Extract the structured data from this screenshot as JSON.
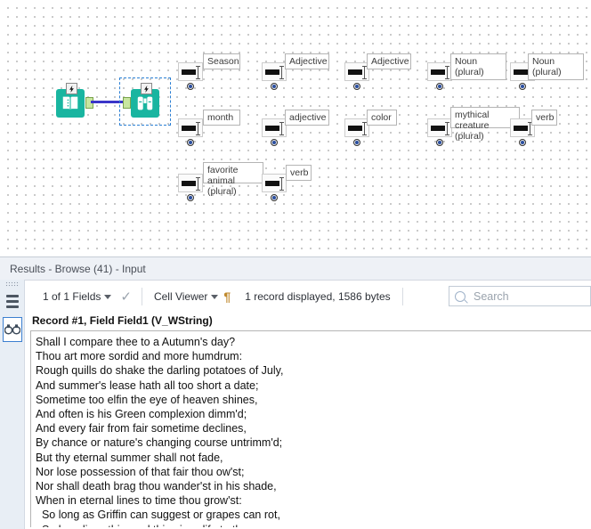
{
  "canvas": {
    "tools": [
      {
        "name": "input-tool",
        "label": "Input",
        "icon": "book-icon"
      },
      {
        "name": "browse-tool",
        "label": "Browse",
        "icon": "binoculars-icon",
        "selected": true
      }
    ],
    "text_widgets": [
      {
        "id": "w1",
        "label": "Season",
        "row": 1,
        "col": 1
      },
      {
        "id": "w2",
        "label": "Adjective",
        "row": 1,
        "col": 2
      },
      {
        "id": "w3",
        "label": "Adjective",
        "row": 1,
        "col": 3
      },
      {
        "id": "w4",
        "label": "Noun (plural)",
        "row": 1,
        "col": 4
      },
      {
        "id": "w5",
        "label": "Noun (plural)",
        "row": 1,
        "col": 5
      },
      {
        "id": "w6",
        "label": "month",
        "row": 2,
        "col": 1
      },
      {
        "id": "w7",
        "label": "adjective",
        "row": 2,
        "col": 2
      },
      {
        "id": "w8",
        "label": "color",
        "row": 2,
        "col": 3
      },
      {
        "id": "w9",
        "label": "mythical creature\n(plural)",
        "row": 2,
        "col": 4
      },
      {
        "id": "w10",
        "label": "verb",
        "row": 2,
        "col": 5
      },
      {
        "id": "w11",
        "label": "favorite animal\n(plural)",
        "row": 3,
        "col": 1
      },
      {
        "id": "w12",
        "label": "verb",
        "row": 3,
        "col": 2
      }
    ]
  },
  "results": {
    "title": "Results - Browse (41) - Input",
    "toolbar": {
      "fields_label": "1 of 1 Fields",
      "viewer_label": "Cell Viewer",
      "status_label": "1 record displayed, 1586 bytes",
      "check_glyph": "✓",
      "pilcrow_glyph": "¶"
    },
    "search": {
      "placeholder": "Search",
      "value": ""
    },
    "rail": {
      "grid_button": "table-view",
      "browse_button": "cell-viewer"
    },
    "record": {
      "header": "Record #1, Field Field1 (V_WString)",
      "text": "Shall I compare thee to a Autumn's day?\nThou art more sordid and more humdrum:\nRough quills do shake the darling potatoes of July,\nAnd summer's lease hath all too short a date;\nSometime too elfin the eye of heaven shines,\nAnd often is his Green complexion dimm'd;\nAnd every fair from fair sometime declines,\nBy chance or nature's changing course untrimm'd;\nBut thy eternal summer shall not fade,\nNor lose possession of that fair thou ow'st;\nNor shall death brag thou wander'st in his shade,\nWhen in eternal lines to time thou grow'st:\n  So long as Griffin can suggest or grapes can rot,\n  So long lives this, and this gives life to thee."
    }
  },
  "colors": {
    "tool_teal": "#19b5a0",
    "wire_blue": "#3a35c8",
    "selection_blue": "#2a7fd4",
    "panel_header": "#eef1f6"
  }
}
